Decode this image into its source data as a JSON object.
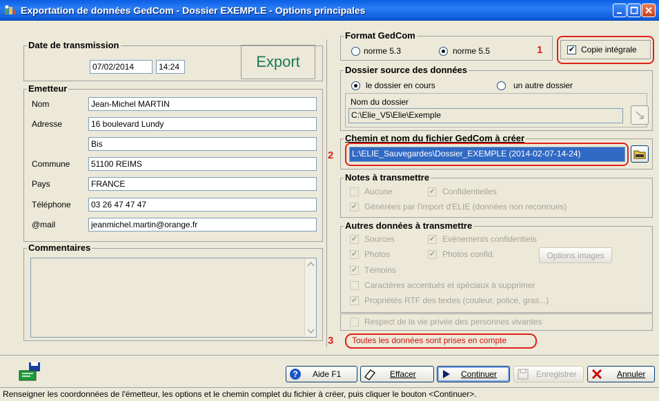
{
  "window": {
    "title": "Exportation de données GedCom - Dossier EXEMPLE - Options principales"
  },
  "transmission": {
    "legend": "Date de transmission",
    "date": "07/02/2014",
    "time": "14:24",
    "export_label": "Export"
  },
  "emetteur": {
    "legend": "Emetteur",
    "fields": [
      {
        "label": "Nom",
        "value": "Jean-Michel MARTIN"
      },
      {
        "label": "Adresse",
        "value": "16 boulevard Lundy"
      },
      {
        "label": "",
        "value": "Bis"
      },
      {
        "label": "Commune",
        "value": "51100  REIMS"
      },
      {
        "label": "Pays",
        "value": "FRANCE"
      },
      {
        "label": "Téléphone",
        "value": "03 26 47 47 47"
      },
      {
        "label": "@mail",
        "value": "jeanmichel.martin@orange.fr"
      }
    ]
  },
  "commentaires": {
    "legend": "Commentaires",
    "value": ""
  },
  "format": {
    "legend": "Format GedCom",
    "option1": "norme 5.3",
    "option2": "norme 5.5",
    "selected": "norme 5.5",
    "copie": "Copie intégrale",
    "copie_checked": true
  },
  "markers": {
    "m1": "1",
    "m2": "2",
    "m3": "3"
  },
  "source": {
    "legend": "Dossier source des données",
    "opt1": "le dossier en cours",
    "opt2": "un autre dossier",
    "selected": "le dossier en cours",
    "nom_label": "Nom du dossier",
    "nom_value": "C:\\Elie_V5\\Elie\\Exemple"
  },
  "chemin": {
    "legend": "Chemin et nom du fichier GedCom à créer",
    "value": "L:\\ELIE_Sauvegardes\\Dossier_EXEMPLE (2014-02-07-14-24)"
  },
  "notes": {
    "legend": "Notes à transmettre",
    "aucune": "Aucune",
    "confidentielles": "Confidentielles",
    "generees": "Générées par l'import d'ELIE (données non reconnues)"
  },
  "autres": {
    "legend": "Autres données à transmettre",
    "sources": "Sources",
    "evenements": "Evènements confidentiels",
    "photos": "Photos",
    "photos_confid": "Photos confid.",
    "options_images": "Options images",
    "temoins": "Témoins",
    "caracteres": "Caractères accentués et spéciaux à supprimer",
    "proprietes": "Propriétés RTF des textes (couleur, police, gras...)",
    "respect": "Respect de la vie privée des personnes vivantes"
  },
  "info": "Toutes les données sont prises en compte",
  "buttons": {
    "aide": "Aide  F1",
    "effacer": "Effacer",
    "continuer": "Continuer",
    "enregistrer": "Enregistrer",
    "annuler": "Annuler"
  },
  "status": "Renseigner les coordonnées de l'émetteur, les options et le chemin complet du fichier à créer, puis cliquer le bouton <Continuer>."
}
